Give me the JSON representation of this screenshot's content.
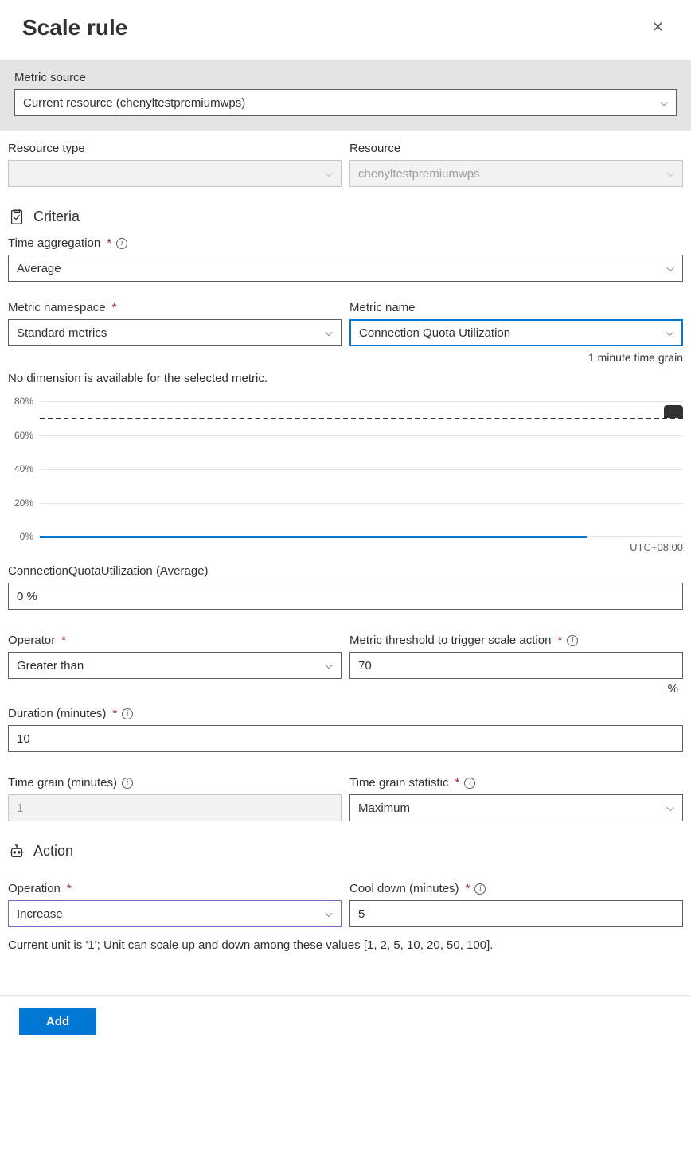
{
  "title": "Scale rule",
  "metric_source": {
    "label": "Metric source",
    "value": "Current resource (chenyltestpremiumwps)"
  },
  "resource_type": {
    "label": "Resource type",
    "value": ""
  },
  "resource": {
    "label": "Resource",
    "value": "chenyltestpremiumwps"
  },
  "criteria": {
    "heading": "Criteria",
    "time_aggregation": {
      "label": "Time aggregation",
      "value": "Average"
    },
    "metric_namespace": {
      "label": "Metric namespace",
      "value": "Standard metrics"
    },
    "metric_name": {
      "label": "Metric name",
      "value": "Connection Quota Utilization",
      "grain_hint": "1 minute time grain"
    },
    "no_dimension": "No dimension is available for the selected metric.",
    "metric_value": {
      "label": "ConnectionQuotaUtilization (Average)",
      "value": "0 %"
    },
    "operator": {
      "label": "Operator",
      "value": "Greater than"
    },
    "threshold": {
      "label": "Metric threshold to trigger scale action",
      "value": "70",
      "unit": "%"
    },
    "duration": {
      "label": "Duration (minutes)",
      "value": "10"
    },
    "time_grain": {
      "label": "Time grain (minutes)",
      "value": "1"
    },
    "time_grain_stat": {
      "label": "Time grain statistic",
      "value": "Maximum"
    }
  },
  "action": {
    "heading": "Action",
    "operation": {
      "label": "Operation",
      "value": "Increase"
    },
    "cooldown": {
      "label": "Cool down (minutes)",
      "value": "5"
    },
    "unit_note": "Current unit is '1'; Unit can scale up and down among these values [1, 2, 5, 10, 20, 50, 100]."
  },
  "footer": {
    "add": "Add"
  },
  "chart_data": {
    "type": "line",
    "title": "",
    "xlabel": "",
    "ylabel": "",
    "ylim": [
      0,
      80
    ],
    "y_ticks": [
      "0%",
      "20%",
      "40%",
      "60%",
      "80%"
    ],
    "threshold": 70,
    "series": [
      {
        "name": "ConnectionQuotaUtilization (Average)",
        "values": [
          0,
          0,
          0,
          0,
          0,
          0,
          0,
          0,
          0,
          0,
          0,
          0
        ]
      }
    ],
    "timezone": "UTC+08:00"
  }
}
